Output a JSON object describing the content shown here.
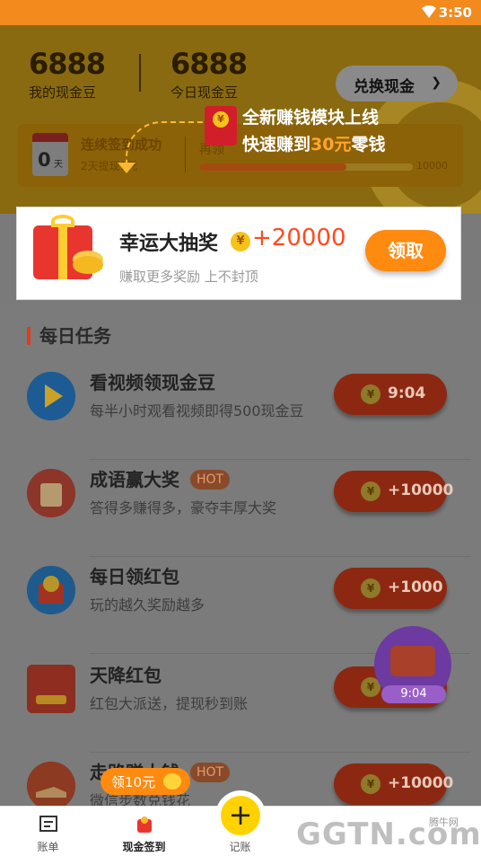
{
  "status_bar": {
    "time": "3:50"
  },
  "header": {
    "my_beans_value": "6888",
    "my_beans_label": "我的现金豆",
    "today_beans_value": "6888",
    "today_beans_label": "今日现金豆",
    "exchange_label": "兑换现金"
  },
  "signin": {
    "days": "0",
    "days_unit": "天",
    "title": "连续签到成功",
    "subtitle": "2天提现1元",
    "mid_label": "再领",
    "progress_max": "10000",
    "progress_fraction": 0.69
  },
  "tooltip": {
    "line1": "全新赚钱模块上线",
    "line2_prefix": "快速赚到",
    "line2_highlight": "30元",
    "line2_suffix": "零钱"
  },
  "lottery": {
    "title": "幸运大抽奖",
    "amount": "+20000",
    "subtitle": "赚取更多奖励 上不封顶",
    "claim_label": "领取"
  },
  "tasks": {
    "section_title": "每日任务",
    "items": [
      {
        "name": "看视频领现金豆",
        "desc": "每半小时观看视频即得500现金豆",
        "button": "9:04",
        "hot": ""
      },
      {
        "name": "成语赢大奖",
        "desc": "答得多赚得多，豪夺丰厚大奖",
        "button": "+10000",
        "hot": "HOT"
      },
      {
        "name": "每日领红包",
        "desc": "玩的越久奖励越多",
        "button": "+1000",
        "hot": ""
      },
      {
        "name": "天降红包",
        "desc": "红包大派送，提现秒到账",
        "button": "",
        "hot": ""
      },
      {
        "name": "走路赚大钱",
        "desc": "微信步数兑钱花",
        "button": "+10000",
        "hot": "HOT"
      }
    ]
  },
  "float_badge": {
    "timer": "9:04"
  },
  "bubble": {
    "label": "领10元"
  },
  "tabbar": {
    "tabs": [
      {
        "label": "账单"
      },
      {
        "label": "现金签到"
      },
      {
        "label": "记账"
      },
      {
        "label": ""
      },
      {
        "label": ""
      }
    ],
    "add_symbol": "+"
  },
  "watermark": {
    "main": "GGTN.com",
    "corner": "腾牛网"
  },
  "colors": {
    "accent": "#ff8a10",
    "status_bar": "#f28a1e",
    "amount": "#ff4a1e"
  }
}
